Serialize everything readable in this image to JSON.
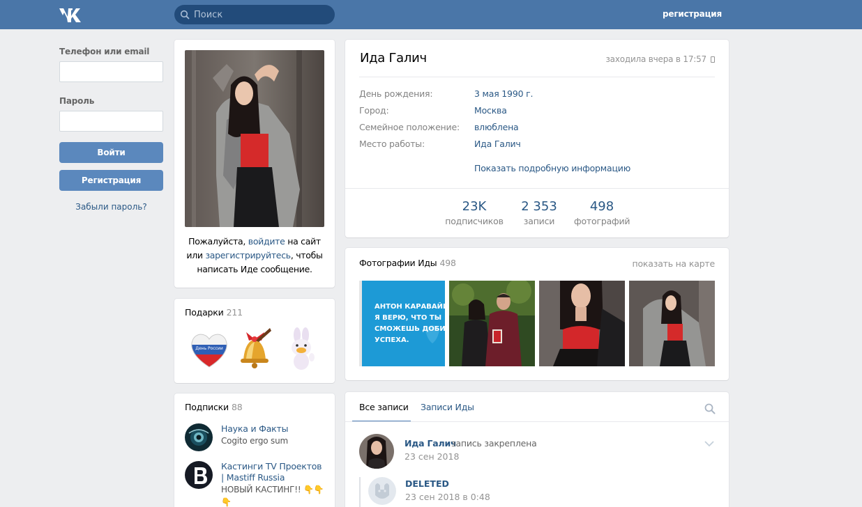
{
  "header": {
    "search_placeholder": "Поиск",
    "register_link": "регистрация",
    "logo_icon": "vk-logo-icon"
  },
  "login": {
    "phone_label": "Телефон или email",
    "password_label": "Пароль",
    "phone_value": "",
    "password_value": "",
    "login_button": "Войти",
    "register_button": "Регистрация",
    "forgot_link": "Забыли пароль?"
  },
  "avatar_card": {
    "msg_prefix": "Пожалуйста,",
    "msg_login": "войдите",
    "msg_mid": "на сайт или",
    "msg_register": "зарегистрируйтесь",
    "msg_suffix": ", чтобы написать Иде сообщение."
  },
  "gifts": {
    "title": "Подарки",
    "count": "211",
    "items": [
      {
        "icon": "heart-russia-gift-icon",
        "text": "День России"
      },
      {
        "icon": "bell-gift-icon"
      },
      {
        "icon": "bunny-gift-icon"
      }
    ]
  },
  "subscriptions": {
    "title": "Подписки",
    "count": "88",
    "items": [
      {
        "name": "Наука и Факты",
        "desc": "Cogito ergo sum"
      },
      {
        "name": "Кастинги TV Проектов | Mastiff Russia",
        "desc": "НОВЫЙ КАСТИНГ!! 👇👇👇"
      }
    ]
  },
  "profile": {
    "name": "Ида Галич",
    "last_seen": "заходила вчера в 17:57",
    "fields": [
      {
        "key": "День рождения:",
        "value": "3 мая 1990 г."
      },
      {
        "key": "Город:",
        "value": "Москва"
      },
      {
        "key": "Семейное положение:",
        "value": "влюблена"
      },
      {
        "key": "Место работы:",
        "value": "Ида Галич"
      }
    ],
    "more_link": "Показать подробную информацию",
    "counters": [
      {
        "num": "23K",
        "label": "подписчиков"
      },
      {
        "num": "2 353",
        "label": "записи"
      },
      {
        "num": "498",
        "label": "фотографий"
      }
    ]
  },
  "photos": {
    "title": "Фотографии Иды",
    "count": "498",
    "map_link": "показать на карте",
    "banner_text": [
      "АНТОН КАРАВАЙЦЕВ",
      "Я ВЕРЮ, ЧТО ТЫ",
      "СМОЖЕШЬ ДОБИТЬСЯ",
      "УСПЕХА."
    ]
  },
  "wall": {
    "tab_all": "Все записи",
    "tab_own": "Записи Иды",
    "post_author": "Ида Галич",
    "post_pinned": "запись закреплена",
    "post_date": "23 сен 2018",
    "repost_name": "DELETED",
    "repost_date": "23 сен 2018 в 0:48"
  },
  "colors": {
    "header_bg": "#4a76a8",
    "button_bg": "#5b88bd",
    "link": "#2a5885",
    "page_bg": "#edeef0"
  }
}
